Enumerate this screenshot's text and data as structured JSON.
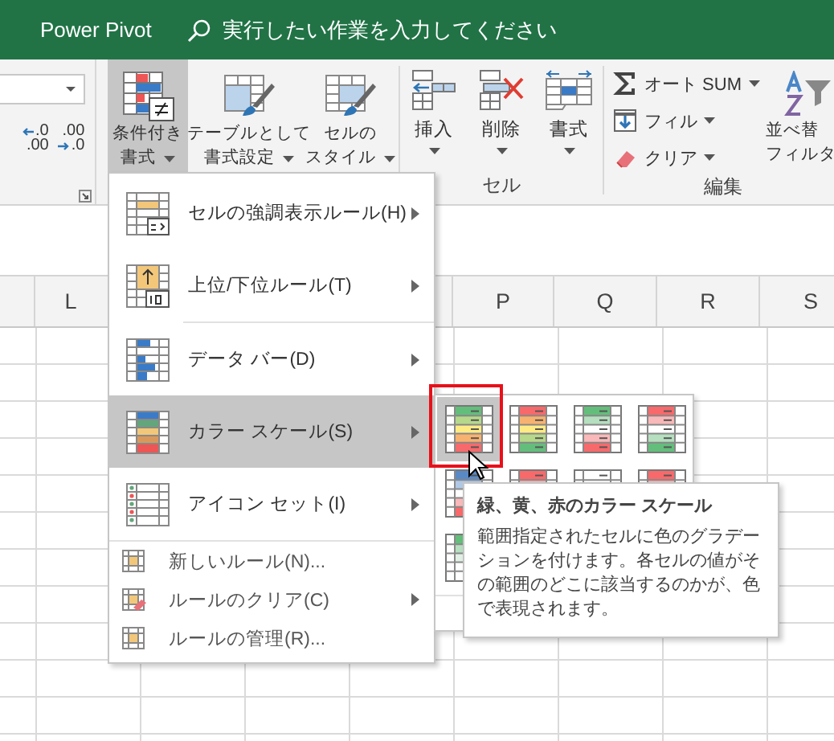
{
  "title_bar": {
    "tab": "Power Pivot",
    "search_placeholder": "実行したい作業を入力してください"
  },
  "ribbon": {
    "decimal_buttons": [
      {
        "top": ".0",
        "bottom": ".00",
        "kind": "increase"
      },
      {
        "top": ".00",
        "bottom": ".0",
        "kind": "decrease"
      }
    ],
    "style_buttons": [
      {
        "lines": [
          "条件付き",
          "書式"
        ],
        "pressed": true
      },
      {
        "lines": [
          "テーブルとして",
          "書式設定"
        ],
        "pressed": false
      },
      {
        "lines": [
          "セルの",
          "スタイル"
        ],
        "pressed": false
      }
    ],
    "cell_buttons": [
      {
        "label": "挿入",
        "kind": "insert"
      },
      {
        "label": "削除",
        "kind": "delete"
      },
      {
        "label": "書式",
        "kind": "format"
      }
    ],
    "cells_group_label": "セル",
    "edit_buttons": [
      {
        "label": "オート SUM",
        "kind": "sum"
      },
      {
        "label": "フィル",
        "kind": "fill"
      },
      {
        "label": "クリア",
        "kind": "clear"
      }
    ],
    "sort_lines": [
      "並べ替",
      "フィルタ"
    ],
    "edit_group_label": "編集"
  },
  "columns": [
    {
      "label": "L"
    },
    {
      "label": "P"
    },
    {
      "label": "Q"
    },
    {
      "label": "R"
    },
    {
      "label": "S"
    }
  ],
  "menu": {
    "items": [
      {
        "kind": "large",
        "label": "セルの強調表示ルール(H)",
        "submenu": true,
        "selected": false,
        "separator_after": false
      },
      {
        "kind": "large",
        "label": "上位/下位ルール(T)",
        "submenu": true,
        "selected": false,
        "separator_after": true
      },
      {
        "kind": "large",
        "label": "データ バー(D)",
        "submenu": true,
        "selected": false,
        "separator_after": false
      },
      {
        "kind": "large",
        "label": "カラー スケール(S)",
        "submenu": true,
        "selected": true,
        "separator_after": false
      },
      {
        "kind": "large",
        "label": "アイコン セット(I)",
        "submenu": true,
        "selected": false,
        "separator_after": true
      },
      {
        "kind": "small",
        "label": "新しいルール(N)...",
        "submenu": false,
        "selected": false,
        "separator_after": false
      },
      {
        "kind": "small",
        "label": "ルールのクリア(C)",
        "submenu": true,
        "selected": false,
        "separator_after": false
      },
      {
        "kind": "small",
        "label": "ルールの管理(R)...",
        "submenu": false,
        "selected": false,
        "separator_after": false
      }
    ]
  },
  "color_scales": [
    {
      "selected": true
    },
    {
      "selected": false
    },
    {
      "selected": false
    },
    {
      "selected": false
    },
    {
      "selected": false
    },
    {
      "selected": false
    },
    {
      "selected": false
    },
    {
      "selected": false
    },
    {
      "selected": false
    }
  ],
  "tooltip": {
    "title": "緑、黄、赤のカラー スケール",
    "body": "範囲指定されたセルに色のグラデーションを付けます。各セルの値がその範囲のどこに該当するのかが、色で表現されます。"
  }
}
